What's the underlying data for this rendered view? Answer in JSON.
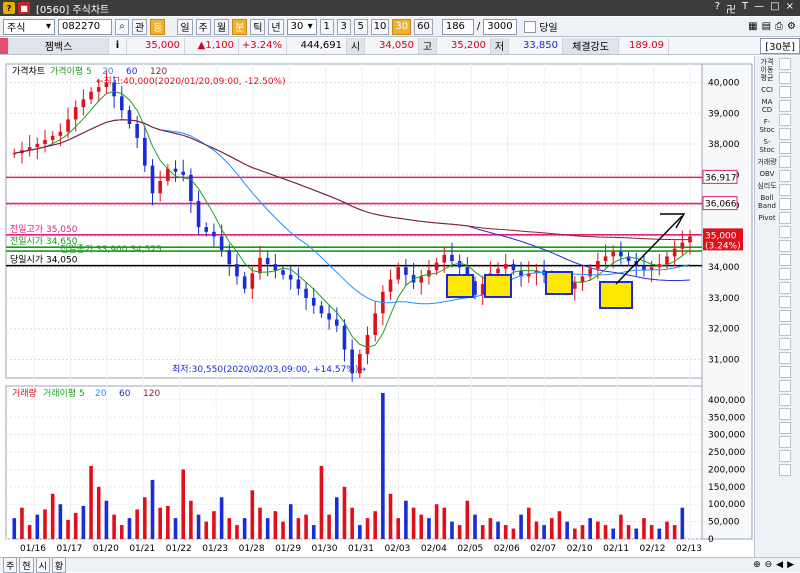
{
  "window": {
    "title": "[0560] 주식차트",
    "controls": [
      "?",
      "卍",
      "T",
      "—",
      "□",
      "×"
    ]
  },
  "toolbar": {
    "market": "주식",
    "code": "082270",
    "search_icon": "search-icon",
    "btn_gwan": "관",
    "btn_mark": "등",
    "periods": [
      "일",
      "주",
      "월",
      "분",
      "틱",
      "년"
    ],
    "period_value": "30",
    "intervals": [
      "1",
      "3",
      "5",
      "10",
      "30",
      "60"
    ],
    "count": "186",
    "slash": "/",
    "total": "3000",
    "today_label": "당일"
  },
  "quote": {
    "name": "젬백스",
    "i_label": "i",
    "price": "35,000",
    "change": "▲1,100",
    "rate": "+3.24%",
    "volume": "444,691",
    "open_label": "시",
    "open": "34,050",
    "high_label": "고",
    "high": "35,200",
    "low_label": "저",
    "low": "33,850",
    "strength_label": "체결강도",
    "strength": "189.09",
    "timeframe": "[30분]"
  },
  "price_panel": {
    "legend": [
      "가격차트",
      "가격이평 5",
      "20",
      "60",
      "120"
    ],
    "high_note": "←최고:40,000(2020/01/20,09:00, -12.50%)",
    "low_note": "최저:30,550(2020/02/03,09:00, +14.57%)→",
    "line_labels": {
      "prev_high": "전일고가 35,050",
      "prev_close": "전일시가 34,650",
      "prev_mid": "전일종가 33,900 34,525",
      "today_open": "당일시가 34,050"
    },
    "right_tags": {
      "r1": "36,917",
      "r2": "36,066",
      "cur": "35,000",
      "cur_rate": "(3.24%)"
    }
  },
  "volume_panel": {
    "legend": [
      "거래량",
      "거래이평 5",
      "20",
      "60",
      "120"
    ]
  },
  "chart_data": {
    "type": "candlestick",
    "price_axis": {
      "ticks": [
        31000,
        32000,
        33000,
        34000,
        35000,
        36000,
        37000,
        38000,
        39000,
        40000
      ],
      "ylim": [
        30400,
        40600
      ]
    },
    "volume_axis": {
      "ticks": [
        0,
        50000,
        100000,
        150000,
        200000,
        250000,
        300000,
        350000,
        400000
      ],
      "ylim": [
        0,
        440000
      ]
    },
    "x_labels": [
      "01/16",
      "01/17",
      "01/20",
      "01/21",
      "01/22",
      "01/23",
      "01/28",
      "01/29",
      "01/30",
      "01/31",
      "02/03",
      "02/04",
      "02/05",
      "02/06",
      "02/07",
      "02/10",
      "02/11",
      "02/12",
      "02/13"
    ],
    "horizontal_lines": [
      {
        "value": 36917,
        "color": "#e0207a"
      },
      {
        "value": 36066,
        "color": "#e0207a"
      },
      {
        "value": 35050,
        "color": "#e0207a"
      },
      {
        "value": 34650,
        "color": "#1a9a1a"
      },
      {
        "value": 34525,
        "color": "#1a9a1a"
      },
      {
        "value": 34050,
        "color": "#000000"
      }
    ],
    "price_path": [
      [
        0,
        37700
      ],
      [
        3,
        38000
      ],
      [
        6,
        38400
      ],
      [
        8,
        39200
      ],
      [
        10,
        39700
      ],
      [
        12,
        40000
      ],
      [
        14,
        39100
      ],
      [
        16,
        38200
      ],
      [
        18,
        36400
      ],
      [
        20,
        37200
      ],
      [
        22,
        37000
      ],
      [
        24,
        35300
      ],
      [
        26,
        35000
      ],
      [
        28,
        34100
      ],
      [
        30,
        33300
      ],
      [
        32,
        34300
      ],
      [
        34,
        33900
      ],
      [
        36,
        33600
      ],
      [
        38,
        33000
      ],
      [
        40,
        32500
      ],
      [
        42,
        32100
      ],
      [
        44,
        30550
      ],
      [
        46,
        31800
      ],
      [
        48,
        33200
      ],
      [
        50,
        34000
      ],
      [
        52,
        33500
      ],
      [
        54,
        33900
      ],
      [
        56,
        34400
      ],
      [
        58,
        34000
      ],
      [
        60,
        33100
      ],
      [
        62,
        33800
      ],
      [
        64,
        34100
      ],
      [
        66,
        33700
      ],
      [
        68,
        33900
      ],
      [
        70,
        33600
      ],
      [
        72,
        33300
      ],
      [
        74,
        33700
      ],
      [
        76,
        34200
      ],
      [
        78,
        34500
      ],
      [
        80,
        34200
      ],
      [
        82,
        33900
      ],
      [
        84,
        34100
      ],
      [
        86,
        34600
      ],
      [
        88,
        35000
      ]
    ],
    "volumes": [
      60,
      90,
      40,
      70,
      85,
      130,
      100,
      55,
      75,
      95,
      210,
      150,
      110,
      70,
      40,
      60,
      85,
      120,
      170,
      90,
      95,
      60,
      200,
      110,
      70,
      50,
      80,
      120,
      60,
      40,
      60,
      140,
      90,
      60,
      80,
      50,
      100,
      60,
      70,
      40,
      210,
      70,
      120,
      150,
      90,
      40,
      60,
      80,
      420,
      130,
      60,
      110,
      90,
      70,
      60,
      100,
      90,
      50,
      40,
      110,
      70,
      40,
      60,
      50,
      40,
      30,
      70,
      90,
      50,
      40,
      60,
      80,
      50,
      30,
      40,
      60,
      50,
      40,
      30,
      70,
      40,
      30,
      60,
      40,
      30,
      50,
      40,
      90
    ],
    "colors": {
      "up": "#e0101a",
      "down": "#1a2bd8",
      "ma5": "#1fa01f",
      "ma20": "#1e90ff",
      "ma60": "#2a2acd",
      "ma120": "#8a2030",
      "highlight": "#ffe800"
    }
  },
  "right_tools": [
    "가격 이동 평균",
    "CCI",
    "MA CD",
    "F-Stoc",
    "S-Stoc",
    "거래량",
    "OBV",
    "심리도",
    "Boll Band",
    "Pivot"
  ],
  "bottom_tabs": [
    "주",
    "현",
    "시",
    "황"
  ]
}
